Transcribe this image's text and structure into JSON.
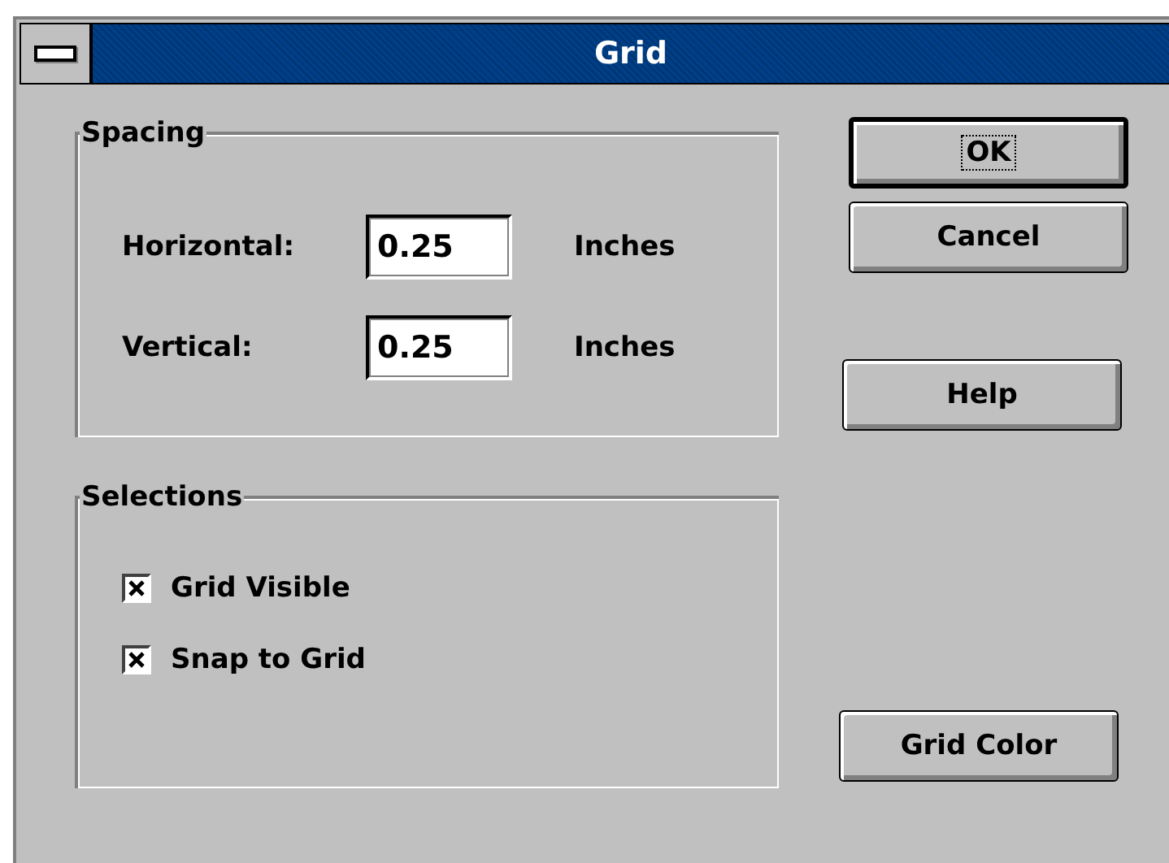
{
  "window": {
    "title": "Grid"
  },
  "spacing": {
    "title": "Spacing",
    "fields": [
      {
        "label": "Horizontal:",
        "value": "0.25",
        "unit": "Inches"
      },
      {
        "label": "Vertical:",
        "value": "0.25",
        "unit": "Inches"
      }
    ]
  },
  "selections": {
    "title": "Selections",
    "options": [
      {
        "label": "Grid Visible",
        "checked": true
      },
      {
        "label": "Snap to Grid",
        "checked": true
      }
    ]
  },
  "buttons": [
    {
      "label": "OK",
      "default": true
    },
    {
      "label": "Cancel",
      "default": false
    },
    {
      "label": "Help",
      "default": false
    },
    {
      "label": "Grid Color",
      "default": false
    }
  ]
}
